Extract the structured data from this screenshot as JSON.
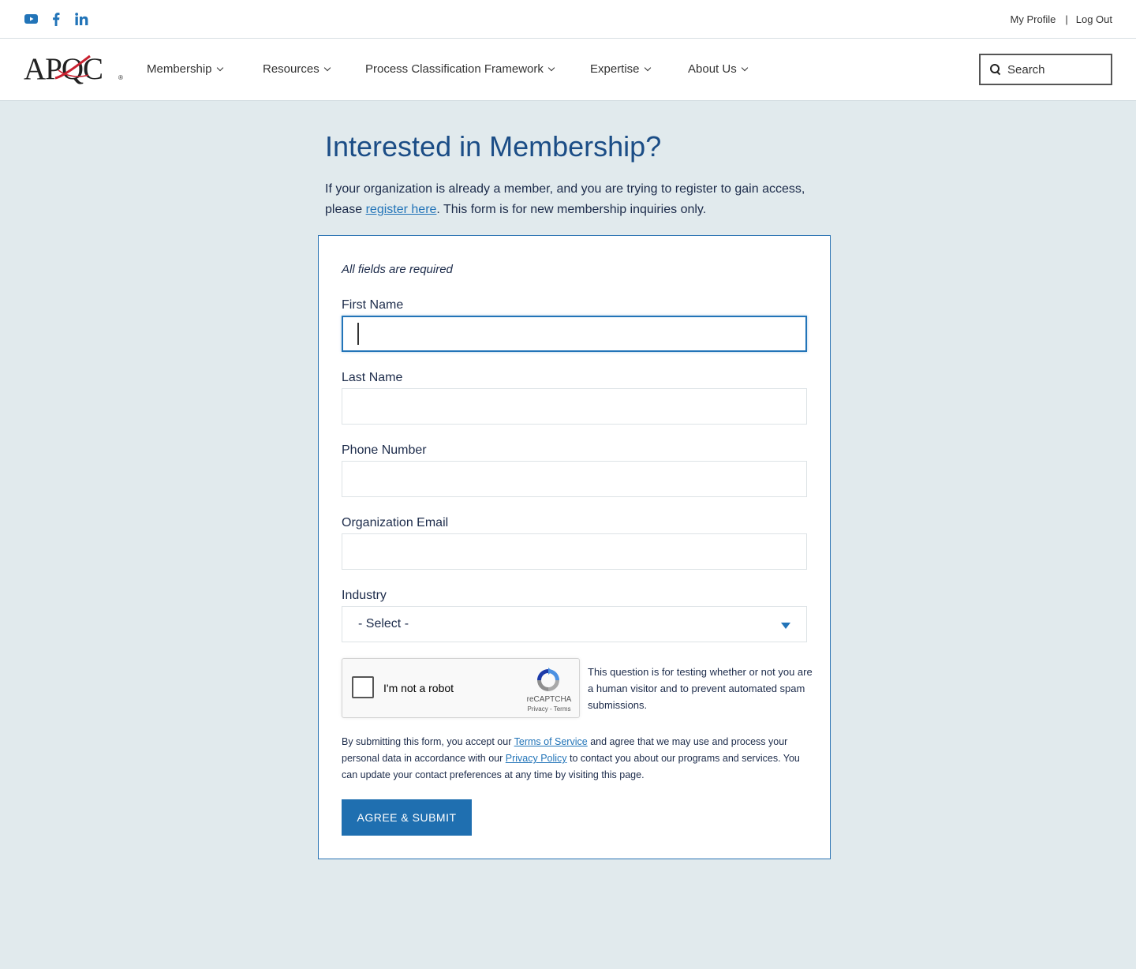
{
  "topbar": {
    "social": [
      {
        "icon": "youtube-icon"
      },
      {
        "icon": "facebook-icon"
      },
      {
        "icon": "linkedin-icon"
      }
    ],
    "my_profile": "My Profile",
    "separator": "|",
    "log_out": "Log Out"
  },
  "navbar": {
    "logo_text": "APQC",
    "logo_reg": "®",
    "items": [
      {
        "label": "Membership"
      },
      {
        "label": "Resources"
      },
      {
        "label": "Process Classification Framework"
      },
      {
        "label": "Expertise"
      },
      {
        "label": "About Us"
      }
    ],
    "search_placeholder": "Search"
  },
  "main": {
    "title": "Interested in Membership?",
    "intro_before": "If your organization is already a member, and you are trying to register to gain access, please ",
    "intro_link": "register here",
    "intro_after": ". This form is for new membership inquiries only."
  },
  "form": {
    "required_note": "All fields are required",
    "fields": [
      {
        "label": "First Name",
        "value": ""
      },
      {
        "label": "Last Name",
        "value": ""
      },
      {
        "label": "Phone Number",
        "value": ""
      },
      {
        "label": "Organization Email",
        "value": ""
      }
    ],
    "industry": {
      "label": "Industry",
      "selected": "- Select -"
    },
    "recaptcha": {
      "label": "I'm not a robot",
      "brand": "reCAPTCHA",
      "terms": "Privacy - Terms"
    },
    "captcha_note": "This question is for testing whether or not you are a human visitor and to prevent automated spam submissions.",
    "legal": {
      "part1": "By submitting this form, you accept our ",
      "terms_link": "Terms of Service",
      "part2": " and agree that we may use and process your personal data in accordance with our ",
      "privacy_link": "Privacy Policy",
      "part3": " to contact you about our programs and services. You can update your contact preferences at any time by visiting this ",
      "page_link": "page",
      "part4": "."
    },
    "submit_label": "AGREE & SUBMIT"
  },
  "colors": {
    "accent": "#2274b8",
    "title": "#1b4d86",
    "background": "#e1eaed",
    "logo_swoosh": "#c8202f"
  }
}
